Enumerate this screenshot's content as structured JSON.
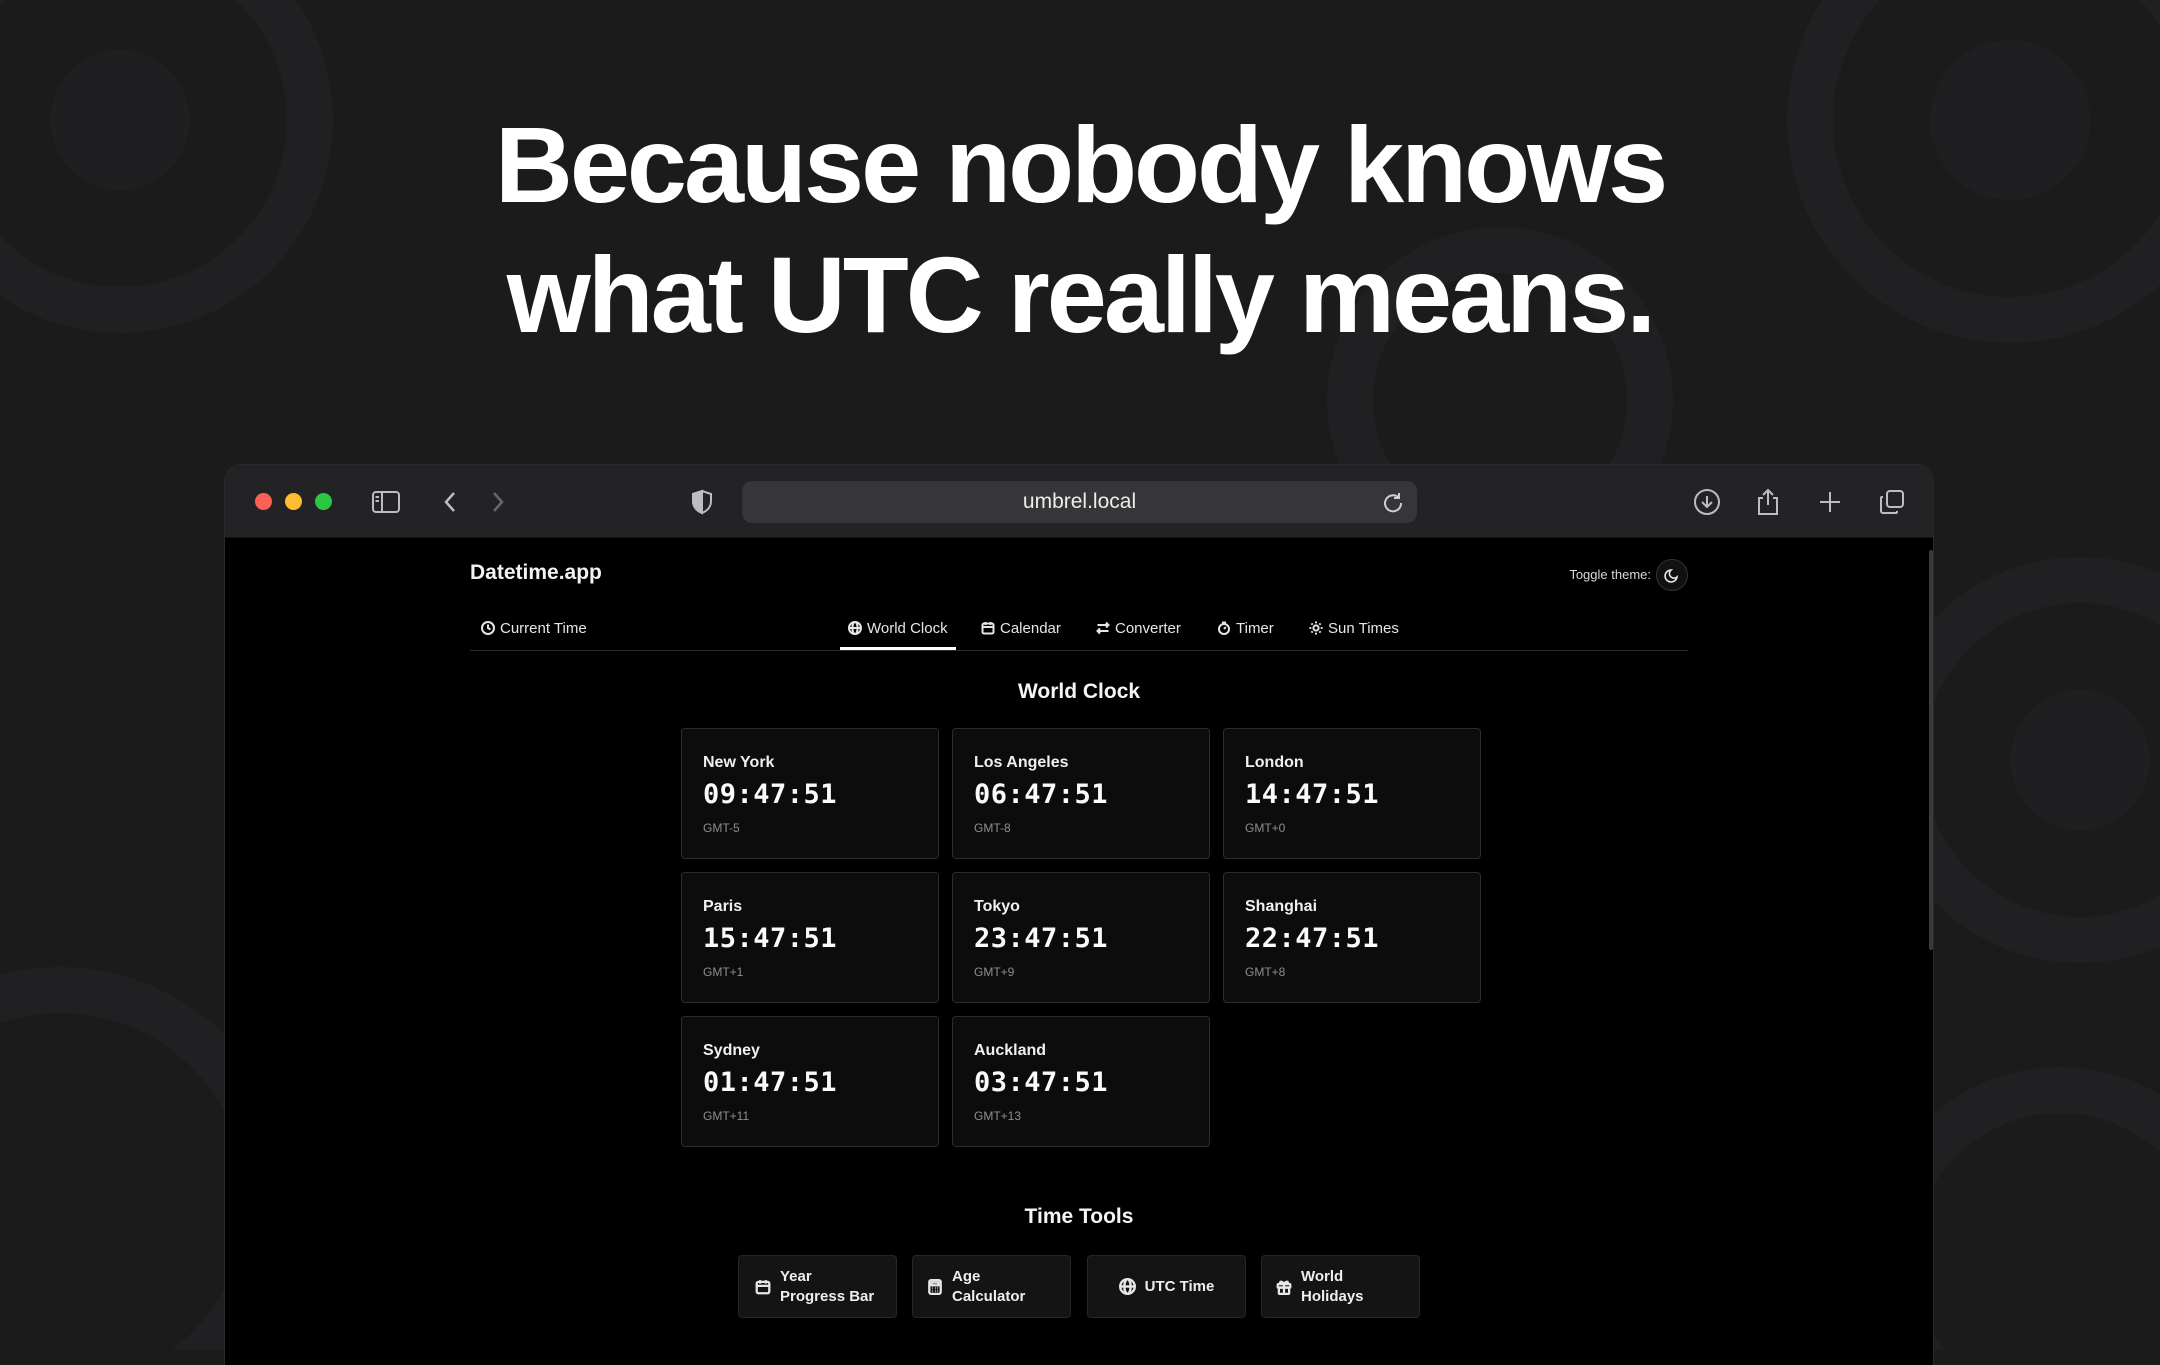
{
  "headline": {
    "line1": "Because nobody knows",
    "line2": "what UTC really means."
  },
  "browser": {
    "url": "umbrel.local"
  },
  "app": {
    "title": "Datetime.app",
    "toggle_theme_label": "Toggle theme:",
    "tabs": [
      {
        "label": "Current Time",
        "icon": "clock-icon",
        "active": false
      },
      {
        "label": "World Clock",
        "icon": "globe-icon",
        "active": true
      },
      {
        "label": "Calendar",
        "icon": "calendar-icon",
        "active": false
      },
      {
        "label": "Converter",
        "icon": "swap-icon",
        "active": false
      },
      {
        "label": "Timer",
        "icon": "stopwatch-icon",
        "active": false
      },
      {
        "label": "Sun Times",
        "icon": "sun-icon",
        "active": false
      }
    ]
  },
  "world_clock": {
    "title": "World Clock",
    "cities": [
      {
        "city": "New York",
        "time": "09:47:51",
        "tz": "GMT-5"
      },
      {
        "city": "Los Angeles",
        "time": "06:47:51",
        "tz": "GMT-8"
      },
      {
        "city": "London",
        "time": "14:47:51",
        "tz": "GMT+0"
      },
      {
        "city": "Paris",
        "time": "15:47:51",
        "tz": "GMT+1"
      },
      {
        "city": "Tokyo",
        "time": "23:47:51",
        "tz": "GMT+9"
      },
      {
        "city": "Shanghai",
        "time": "22:47:51",
        "tz": "GMT+8"
      },
      {
        "city": "Sydney",
        "time": "01:47:51",
        "tz": "GMT+11"
      },
      {
        "city": "Auckland",
        "time": "03:47:51",
        "tz": "GMT+13"
      }
    ]
  },
  "time_tools": {
    "title": "Time Tools",
    "items": [
      {
        "label": "Year Progress Bar",
        "icon": "calendar-icon"
      },
      {
        "label": "Age Calculator",
        "icon": "calculator-icon"
      },
      {
        "label": "UTC Time",
        "icon": "globe-icon"
      },
      {
        "label": "World Holidays",
        "icon": "gift-icon"
      }
    ]
  }
}
